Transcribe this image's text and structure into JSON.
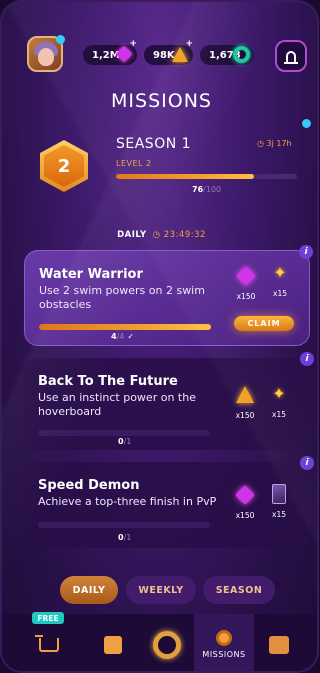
{
  "header": {
    "currencies": [
      {
        "value": "1,2M",
        "icon": "pink-gem-icon",
        "has_plus": true
      },
      {
        "value": "98K",
        "icon": "gold-triangle-icon",
        "has_plus": true
      },
      {
        "value": "1,678",
        "icon": "green-ring-icon",
        "has_plus": false
      }
    ],
    "title": "MISSIONS"
  },
  "season": {
    "level_number": "2",
    "title": "SEASON 1",
    "timer": "◷ 3j 17h",
    "level_label": "LEVEL 2",
    "progress_current": "76",
    "progress_total": "/100",
    "progress_fraction": 0.76
  },
  "daily": {
    "label": "DAILY",
    "timer": "◷ 23:49:32"
  },
  "missions": [
    {
      "title": "Water Warrior",
      "description": "Use 2 swim powers on 2 swim obstacles",
      "progress_current": "4",
      "progress_total": "/4",
      "progress_fraction": 1.0,
      "rewards": [
        {
          "icon": "pink-gem-icon",
          "amount": "x150"
        },
        {
          "icon": "spark-icon",
          "amount": "x15"
        }
      ],
      "claim_label": "CLAIM"
    },
    {
      "title": "Back To The Future",
      "description": "Use an instinct power on the hoverboard",
      "progress_current": "0",
      "progress_total": "/1",
      "progress_fraction": 0,
      "rewards": [
        {
          "icon": "gold-triangle-icon",
          "amount": "x150"
        },
        {
          "icon": "spark-icon",
          "amount": "x15"
        }
      ]
    },
    {
      "title": "Speed Demon",
      "description": "Achieve a top-three finish in PvP",
      "progress_current": "0",
      "progress_total": "/1",
      "progress_fraction": 0,
      "rewards": [
        {
          "icon": "pink-gem-icon",
          "amount": "x150"
        },
        {
          "icon": "character-card-icon",
          "amount": "x15"
        }
      ]
    }
  ],
  "tabs": [
    {
      "label": "DAILY",
      "active": true
    },
    {
      "label": "WEEKLY",
      "active": false
    },
    {
      "label": "SEASON",
      "active": false
    }
  ],
  "nav": {
    "free_badge": "FREE",
    "items": [
      {
        "icon": "cart-icon",
        "label": ""
      },
      {
        "icon": "shopping-bag-icon",
        "label": ""
      },
      {
        "icon": "ring-logo-icon",
        "label": ""
      },
      {
        "icon": "medal-icon",
        "label": "MISSIONS"
      },
      {
        "icon": "calendar-icon",
        "label": ""
      }
    ]
  },
  "colors": {
    "accent_orange": "#f0a040",
    "gem_pink": "#d033e8",
    "ring_green": "#1fc9a0",
    "notification_blue": "#33c9ff"
  }
}
